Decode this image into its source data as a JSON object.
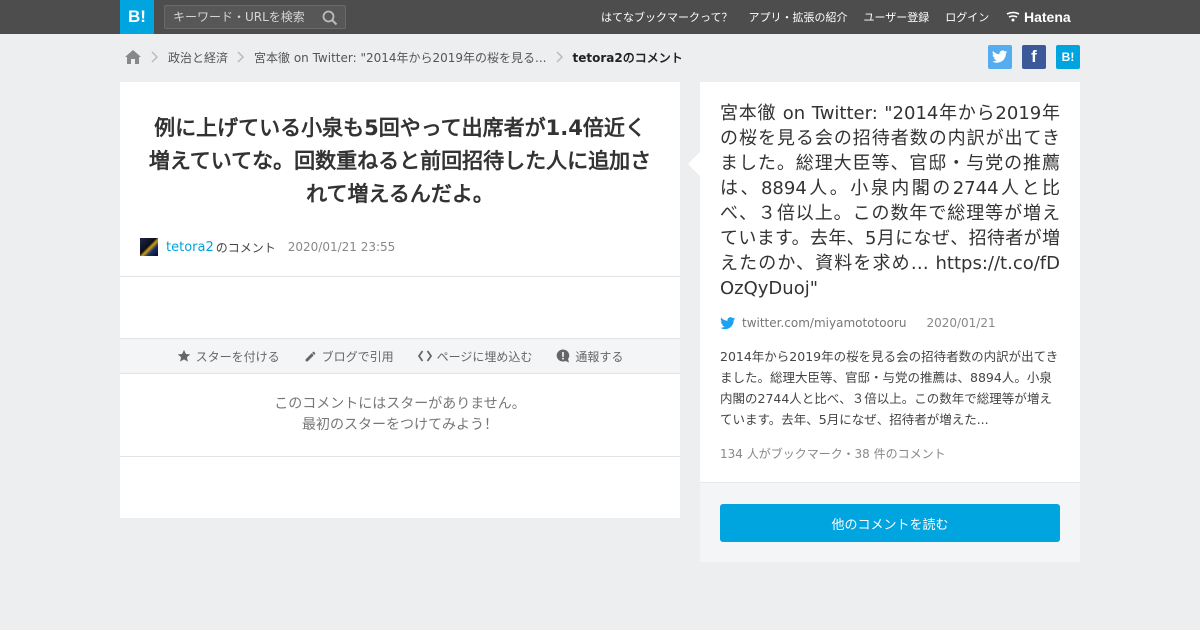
{
  "header": {
    "logo": "B!",
    "search_placeholder": "キーワード・URLを検索",
    "nav": [
      "はてなブックマークって？",
      "アプリ・拡張の紹介",
      "ユーザー登録",
      "ログイン"
    ],
    "brand": "Hatena"
  },
  "breadcrumb": {
    "category": "政治と経済",
    "entry": "宮本徹 on Twitter: \"2014年から2019年の桜を見る...",
    "current": "tetora2のコメント"
  },
  "share": {
    "twitter_color": "#55acee",
    "facebook_color": "#3b5998",
    "hatena_color": "#00a4de",
    "facebook_glyph": "f",
    "hatena_glyph": "B!"
  },
  "comment": {
    "text": "例に上げている小泉も5回やって出席者が1.4倍近く増えていてな。回数重ねると前回招待した人に追加されて増えるんだよ。",
    "user": "tetora2",
    "suffix": "のコメント",
    "date": "2020/01/21 23:55"
  },
  "actions": {
    "star": "スターを付ける",
    "blog": "ブログで引用",
    "embed": "ページに埋め込む",
    "report": "通報する"
  },
  "nostar": {
    "line1": "このコメントにはスターがありません。",
    "line2": "最初のスターをつけてみよう！"
  },
  "entry": {
    "title": "宮本徹 on Twitter: \"2014年から2019年の桜を見る会の招待者数の内訳が出てきました。総理大臣等、官邸・与党の推薦は、8894人。小泉内閣の2744人と比べ、３倍以上。この数年で総理等が増えています。去年、5月になぜ、招待者が増えたのか、資料を求め… https://t.co/fDOzQyDuoj\"",
    "source": "twitter.com/miyamototooru",
    "date": "2020/01/21",
    "summary": "2014年から2019年の桜を見る会の招待者数の内訳が出てきました。総理大臣等、官邸・与党の推薦は、8894人。小泉内閣の2744人と比べ、３倍以上。この数年で総理等が増えています。去年、5月になぜ、招待者が増えた...",
    "counts": "134 人がブックマーク・38 件のコメント",
    "button": "他のコメントを読む"
  }
}
